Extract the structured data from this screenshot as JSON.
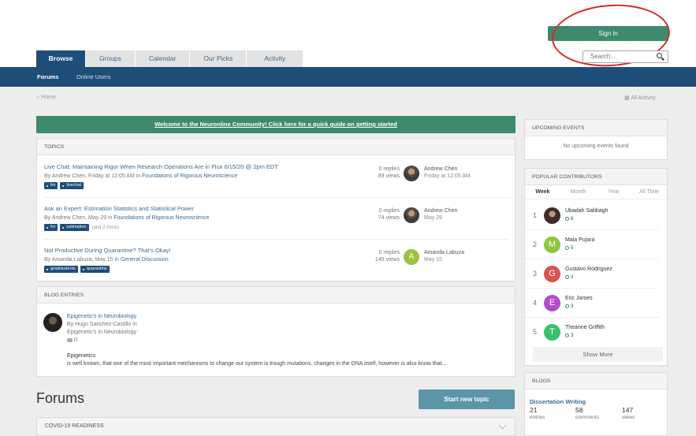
{
  "header": {
    "signin_label": "Sign in",
    "search_placeholder": "Search..."
  },
  "tabs": [
    {
      "label": "Browse",
      "active": true
    },
    {
      "label": "Groups"
    },
    {
      "label": "Calendar"
    },
    {
      "label": "Our Picks"
    },
    {
      "label": "Activity"
    }
  ],
  "subnav": {
    "items": [
      "Forums",
      "Online Users"
    ]
  },
  "breadcrumb": {
    "home": "Home",
    "all_activity": "All Activity"
  },
  "banner": {
    "text": "Welcome to the Neuronline Community! Click here for a quick guide on getting started"
  },
  "topics": {
    "header": "TOPICS",
    "items": [
      {
        "title": "Live Chat: Maintaining Rigor When Research Operations Are in Flux 6/15/20 @ 2pm EDT",
        "meta_by": "By Andrew Chen, Friday at 12:05 AM in",
        "meta_forum": "Foundations of Rigorous Neuroscience",
        "tags": [
          "frn",
          "livechat"
        ],
        "more": "",
        "replies": "0 replies",
        "views": "89 views",
        "last_user": "Andrew Chen",
        "last_time": "Friday at 12:05 AM"
      },
      {
        "title": "Ask an Expert: Estimation Statistics and Statistical Power",
        "meta_by": "By Andrew Chen, May 29 in",
        "meta_forum": "Foundations of Rigorous Neuroscience",
        "tags": [
          "frn",
          "estimation"
        ],
        "more": "(and 2 more)",
        "replies": "0 replies",
        "views": "74 views",
        "last_user": "Andrew Chen",
        "last_time": "May 29"
      },
      {
        "title": "Not Productive During Quarantine? That's Okay!",
        "meta_by": "By Amanda Labuza, May 15 in",
        "meta_forum": "General Discussion",
        "tags": [
          "gradstudents",
          "quarantine"
        ],
        "more": "",
        "replies": "0 replies",
        "views": "145 views",
        "last_user": "Amanda Labuza",
        "last_time": "May 15",
        "avatar_letter": "A"
      }
    ]
  },
  "blog_entries": {
    "header": "BLOG ENTRIES",
    "title": "Epigenetic's in Neurobiology",
    "by": "By Hugo Sanchez-Castillo in",
    "blog": "Epigenetic's in Neurobiology",
    "comments": "0",
    "subtitle": "Epigenetics",
    "excerpt": "is well known, that one of the most important mechanisms to change our system is trough mutations, changes in the DNA itself, however is also know that..."
  },
  "forums": {
    "title": "Forums",
    "start_topic": "Start new topic",
    "category": "COVID-19 READINESS"
  },
  "upcoming_events": {
    "header": "UPCOMING EVENTS",
    "empty": "No upcoming events found"
  },
  "popular_contributors": {
    "header": "POPULAR CONTRIBUTORS",
    "tabs": [
      "Week",
      "Month",
      "Year",
      "All Time"
    ],
    "items": [
      {
        "rank": "1",
        "name": "Ubadah Sabbagh",
        "rep": "8",
        "letter": "",
        "color": "#5b4a3c"
      },
      {
        "rank": "2",
        "name": "Maia Pujara",
        "rep": "5",
        "letter": "M",
        "color": "#8cc63f"
      },
      {
        "rank": "3",
        "name": "Gustavo Rodriguez",
        "rep": "3",
        "letter": "G",
        "color": "#d9534f"
      },
      {
        "rank": "4",
        "name": "Eric James",
        "rep": "3",
        "letter": "E",
        "color": "#b54bc9"
      },
      {
        "rank": "5",
        "name": "Theanne Griffith",
        "rep": "3",
        "letter": "T",
        "color": "#3cbf6a"
      }
    ],
    "show_more": "Show More"
  },
  "blogs": {
    "header": "BLOGS",
    "title": "Dissertation Writing",
    "entries": "21",
    "entries_label": "entries",
    "comments": "58",
    "comments_label": "comments",
    "views": "147",
    "views_label": "views"
  }
}
